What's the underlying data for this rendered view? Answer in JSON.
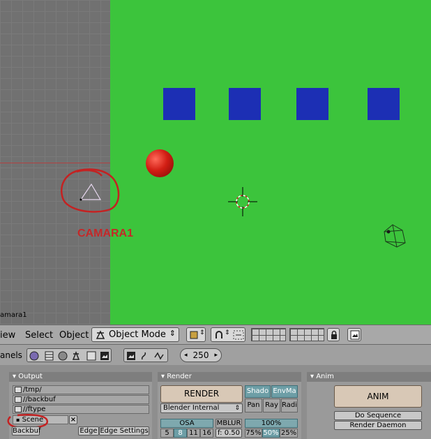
{
  "viewport": {
    "camera_label": "CAMARA1",
    "view_name": "amara1"
  },
  "header": {
    "menu_view": "iew",
    "menu_select": "Select",
    "menu_object": "Object",
    "mode": "Object Mode"
  },
  "panelbar": {
    "label": "anels",
    "frame_value": "250"
  },
  "output": {
    "title": "Output",
    "paths": [
      "/tmp/",
      "//backbuf",
      "//ftype"
    ],
    "scene_value": "Scene",
    "backbuf_label": "Backbuf",
    "edge_label": "Edge",
    "edge_settings_label": "Edge Settings"
  },
  "render": {
    "title": "Render",
    "render_button": "RENDER",
    "engine": "Blender Internal",
    "shado": "Shado",
    "envma": "EnvMa",
    "pan": "Pan",
    "ray": "Ray",
    "radi": "Radi",
    "osa": "OSA",
    "mblur": "MBLUR",
    "percent_100": "100%",
    "osa_levels": [
      "5",
      "8",
      "11",
      "16"
    ],
    "mblur_f": "f: 0.50",
    "sizes": [
      "75%",
      "50%",
      "25%"
    ]
  },
  "anim": {
    "title": "Anim",
    "anim_button": "ANIM",
    "do_sequence": "Do Sequence",
    "render_daemon": "Render Daemon"
  }
}
